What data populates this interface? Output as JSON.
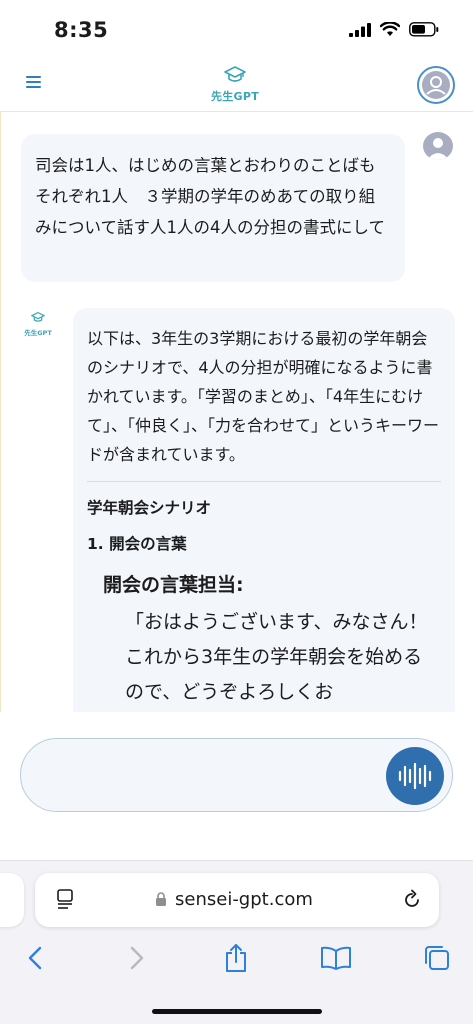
{
  "status": {
    "time": "8:35"
  },
  "header": {
    "logo_text": "先生GPT"
  },
  "chat": {
    "user_message": "司会は1人、はじめの言葉とおわりのことばもそれぞれ1人　３学期の学年のめあての取り組みについて話す人1人の4人の分担の書式にして",
    "bot_logo_text": "先生GPT",
    "bot_intro": "以下は、3年生の3学期における最初の学年朝会のシナリオで、4人の分担が明確になるように書かれています。「学習のまとめ」、「4年生にむけて」、「仲良く」、「力を合わせて」というキーワードが含まれています。",
    "scenario_heading": "学年朝会シナリオ",
    "section_heading": "1. 開会の言葉",
    "role_title": "開会の言葉担当:",
    "role_speech": "「おはようございます、みなさん！これから3年生の学年朝会を始めるので、どうぞよろしくお"
  },
  "input": {
    "placeholder": ""
  },
  "browser": {
    "url": "sensei-gpt.com"
  },
  "icons": {
    "menu": "hamburger-menu-icon",
    "user": "user-avatar-icon",
    "voice": "voice-waveform-icon",
    "reader": "reader-icon",
    "lock": "lock-icon",
    "reload": "reload-icon",
    "back": "chevron-left-icon",
    "forward": "chevron-right-icon",
    "share": "share-icon",
    "bookmarks": "book-icon",
    "tabs": "tabs-icon"
  },
  "colors": {
    "accent": "#2f6fae",
    "logo": "#3aa6b5",
    "bubble": "#f3f7fb",
    "link": "#2f7fbf"
  }
}
